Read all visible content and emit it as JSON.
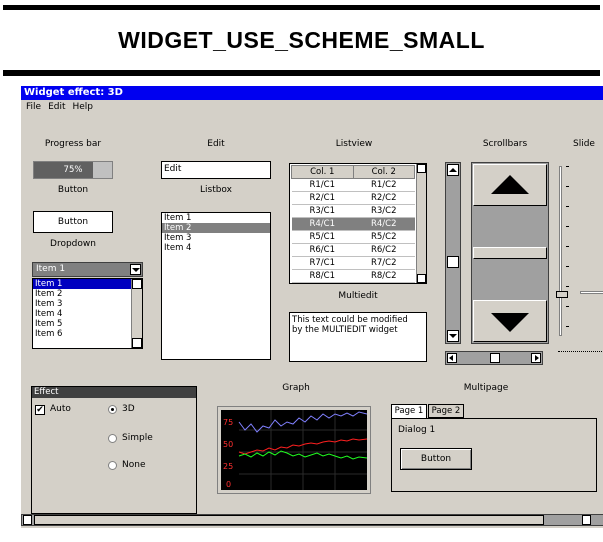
{
  "doc_title": "WIDGET_USE_SCHEME_SMALL",
  "window": {
    "title": "Widget effect: 3D",
    "menu": [
      "File",
      "Edit",
      "Help"
    ]
  },
  "progress": {
    "label": "Progress bar",
    "text": "75%",
    "value": 0.75
  },
  "button1": {
    "label": "Button",
    "text": "Button"
  },
  "dropdown": {
    "label": "Dropdown",
    "selected": "Item 1",
    "items": [
      "Item 1",
      "Item 2",
      "Item 3",
      "Item 4",
      "Item 5",
      "Item 6"
    ]
  },
  "edit": {
    "label": "Edit",
    "value": "Edit"
  },
  "listbox": {
    "label": "Listbox",
    "items": [
      "Item 1",
      "Item 2",
      "Item 3",
      "Item 4"
    ]
  },
  "listview": {
    "label": "Listview",
    "columns": [
      "Col. 1",
      "Col. 2"
    ],
    "rows": [
      [
        "R1/C1",
        "R1/C2"
      ],
      [
        "R2/C1",
        "R2/C2"
      ],
      [
        "R3/C1",
        "R3/C2"
      ],
      [
        "R4/C1",
        "R4/C2"
      ],
      [
        "R5/C1",
        "R5/C2"
      ],
      [
        "R6/C1",
        "R6/C2"
      ],
      [
        "R7/C1",
        "R7/C2"
      ],
      [
        "R8/C1",
        "R8/C2"
      ]
    ]
  },
  "multiedit": {
    "label": "Multiedit",
    "line1": "This text could be modified",
    "line2": "by the MULTIEDIT widget"
  },
  "scrollbars": {
    "label": "Scrollbars"
  },
  "slider": {
    "label": "Slide"
  },
  "effect": {
    "title": "Effect",
    "auto": "Auto",
    "opt3d": "3D",
    "simple": "Simple",
    "none": "None"
  },
  "graph": {
    "label": "Graph",
    "yticks": [
      "75",
      "50",
      "25",
      "0"
    ]
  },
  "multipage": {
    "label": "Multipage",
    "tab1": "Page 1",
    "tab2": "Page 2",
    "dialog": "Dialog 1",
    "button": "Button"
  },
  "colors": {
    "titlebar": "#0000f0",
    "window": "#d4d0c8",
    "graph_bg": "#000000",
    "series_blue": "#8080ff",
    "series_red": "#ff2020",
    "series_green": "#20ff20"
  }
}
